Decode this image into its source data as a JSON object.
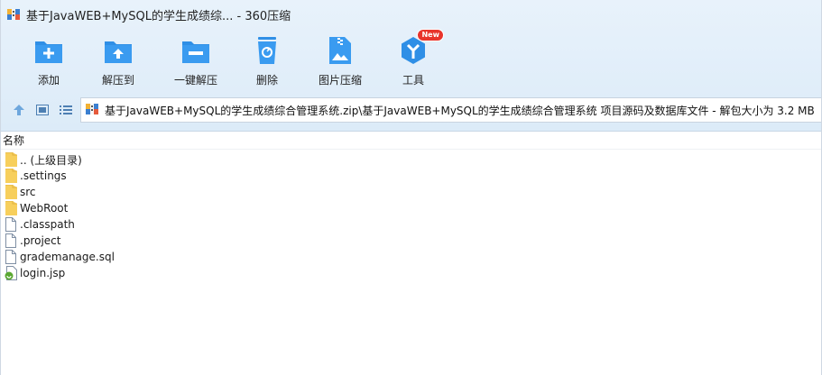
{
  "window": {
    "title": "基于JavaWEB+MySQL的学生成绩综... - 360压缩"
  },
  "toolbar": {
    "items": [
      {
        "label": "添加",
        "icon": "add-icon"
      },
      {
        "label": "解压到",
        "icon": "extract-to-icon"
      },
      {
        "label": "一键解压",
        "icon": "one-click-extract-icon"
      },
      {
        "label": "删除",
        "icon": "delete-icon"
      },
      {
        "label": "图片压缩",
        "icon": "image-compress-icon"
      },
      {
        "label": "工具",
        "icon": "tools-icon",
        "badge": "New"
      }
    ]
  },
  "address": {
    "path": "基于JavaWEB+MySQL的学生成绩综合管理系统.zip\\基于JavaWEB+MySQL的学生成绩综合管理系统 项目源码及数据库文件 - 解包大小为 3.2 MB"
  },
  "list": {
    "column_name": "名称",
    "items": [
      {
        "name": ".. (上级目录)",
        "type": "folder"
      },
      {
        "name": ".settings",
        "type": "folder"
      },
      {
        "name": "src",
        "type": "folder"
      },
      {
        "name": "WebRoot",
        "type": "folder"
      },
      {
        "name": ".classpath",
        "type": "file"
      },
      {
        "name": ".project",
        "type": "file"
      },
      {
        "name": "grademanage.sql",
        "type": "file"
      },
      {
        "name": "login.jsp",
        "type": "jsp"
      }
    ]
  },
  "colors": {
    "accent": "#2f8fe6",
    "badge": "#e8342c",
    "folder": "#f7cf5c"
  }
}
